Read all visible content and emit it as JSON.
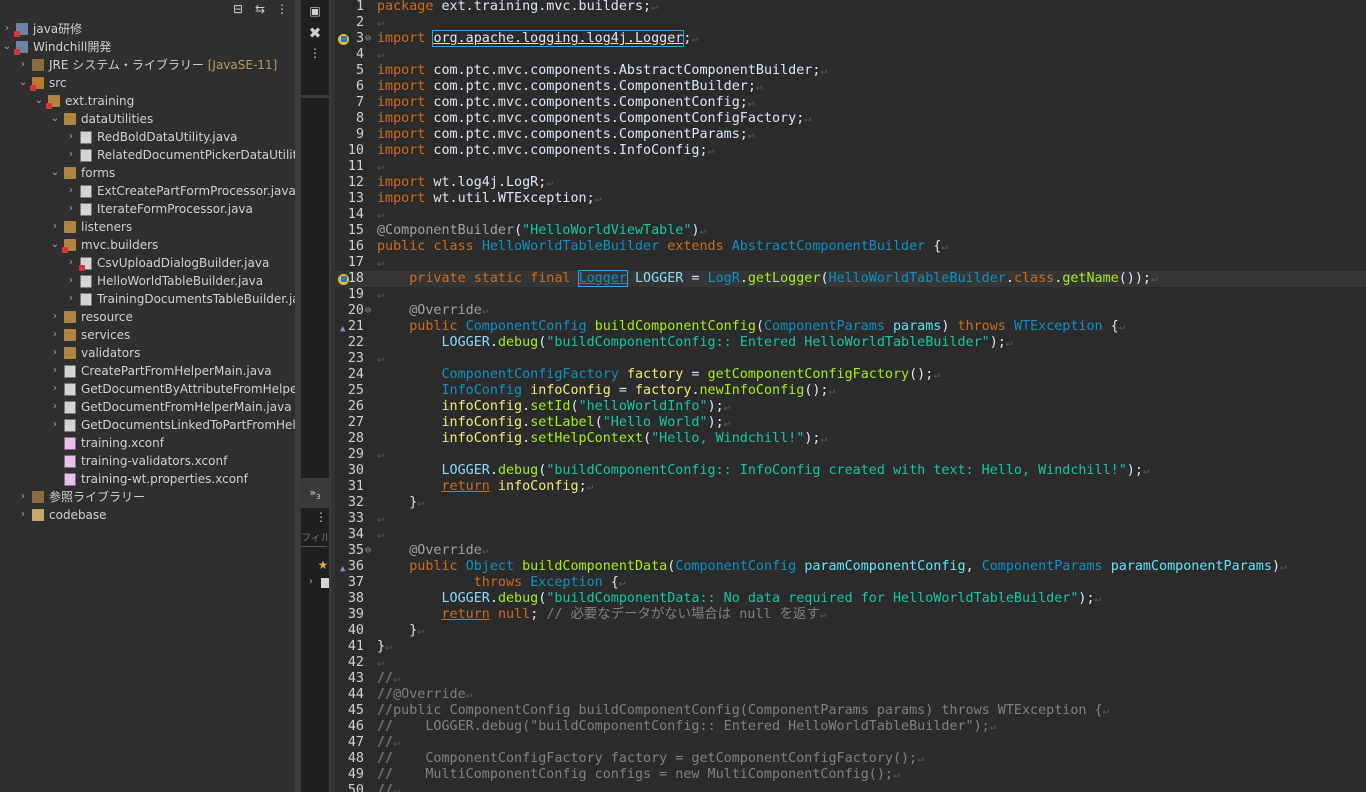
{
  "explorer": {
    "toolbar": [
      "collapse-all-icon",
      "link-editor-icon",
      "view-menu-icon"
    ],
    "items": [
      {
        "label": "java研修",
        "depth": 0,
        "expanded": false,
        "icon": "project-icon",
        "error": true
      },
      {
        "label": "Windchill開発",
        "depth": 0,
        "expanded": true,
        "icon": "project-icon",
        "error": true
      },
      {
        "label": "JRE システム・ライブラリー",
        "decoration": "[JavaSE-11]",
        "depth": 1,
        "expanded": false,
        "icon": "library-icon"
      },
      {
        "label": "src",
        "depth": 1,
        "expanded": true,
        "icon": "source-folder-icon",
        "error": true
      },
      {
        "label": "ext.training",
        "depth": 2,
        "expanded": true,
        "icon": "package-icon",
        "error": true
      },
      {
        "label": "dataUtilities",
        "depth": 3,
        "expanded": true,
        "icon": "package-icon"
      },
      {
        "label": "RedBoldDataUtility.java",
        "depth": 4,
        "expanded": false,
        "icon": "java-file-icon"
      },
      {
        "label": "RelatedDocumentPickerDataUtility.java",
        "depth": 4,
        "expanded": false,
        "icon": "java-file-icon"
      },
      {
        "label": "forms",
        "depth": 3,
        "expanded": true,
        "icon": "package-icon"
      },
      {
        "label": "ExtCreatePartFormProcessor.java",
        "depth": 4,
        "expanded": false,
        "icon": "java-file-icon"
      },
      {
        "label": "IterateFormProcessor.java",
        "depth": 4,
        "expanded": false,
        "icon": "java-file-icon"
      },
      {
        "label": "listeners",
        "depth": 3,
        "expanded": false,
        "icon": "package-icon"
      },
      {
        "label": "mvc.builders",
        "depth": 3,
        "expanded": true,
        "icon": "package-icon",
        "error": true
      },
      {
        "label": "CsvUploadDialogBuilder.java",
        "depth": 4,
        "expanded": false,
        "icon": "java-file-icon",
        "error": true
      },
      {
        "label": "HelloWorldTableBuilder.java",
        "depth": 4,
        "expanded": false,
        "icon": "java-file-icon"
      },
      {
        "label": "TrainingDocumentsTableBuilder.java",
        "depth": 4,
        "expanded": false,
        "icon": "java-file-icon"
      },
      {
        "label": "resource",
        "depth": 3,
        "expanded": false,
        "icon": "package-icon"
      },
      {
        "label": "services",
        "depth": 3,
        "expanded": false,
        "icon": "package-icon"
      },
      {
        "label": "validators",
        "depth": 3,
        "expanded": false,
        "icon": "package-icon"
      },
      {
        "label": "CreatePartFromHelperMain.java",
        "depth": 3,
        "expanded": false,
        "icon": "java-file-icon"
      },
      {
        "label": "GetDocumentByAttributeFromHelperMain.java",
        "depth": 3,
        "expanded": false,
        "icon": "java-file-icon"
      },
      {
        "label": "GetDocumentFromHelperMain.java",
        "depth": 3,
        "expanded": false,
        "icon": "java-file-icon"
      },
      {
        "label": "GetDocumentsLinkedToPartFromHelperMain.java",
        "depth": 3,
        "expanded": false,
        "icon": "java-file-icon"
      },
      {
        "label": "training.xconf",
        "depth": 3,
        "leaf": true,
        "icon": "xconf-file-icon"
      },
      {
        "label": "training-validators.xconf",
        "depth": 3,
        "leaf": true,
        "icon": "xconf-file-icon"
      },
      {
        "label": "training-wt.properties.xconf",
        "depth": 3,
        "leaf": true,
        "icon": "xconf-file-icon"
      },
      {
        "label": "参照ライブラリー",
        "depth": 1,
        "expanded": false,
        "icon": "library-icon"
      },
      {
        "label": "codebase",
        "depth": 1,
        "expanded": false,
        "icon": "folder-icon"
      }
    ]
  },
  "side_panel": {
    "overflow_label": "»",
    "overflow_count": "3",
    "filter_placeholder": "フィルタ"
  },
  "editor": {
    "lines": [
      {
        "n": "1",
        "t": [
          [
            "kw",
            "package"
          ],
          [
            "p",
            " ext.training.mvc.builders;"
          ]
        ]
      },
      {
        "n": "2",
        "t": []
      },
      {
        "n": "3",
        "marker": "warning",
        "fold": "⊖",
        "t": [
          [
            "kw",
            "import"
          ],
          [
            "p",
            " "
          ],
          [
            "hl",
            "org.apache.logging.log4j.Logger"
          ],
          [
            "p",
            ";"
          ]
        ]
      },
      {
        "n": "4",
        "t": []
      },
      {
        "n": "5",
        "t": [
          [
            "kw",
            "import"
          ],
          [
            "p",
            " com.ptc.mvc.components.AbstractComponentBuilder;"
          ]
        ]
      },
      {
        "n": "6",
        "t": [
          [
            "kw",
            "import"
          ],
          [
            "p",
            " com.ptc.mvc.components.ComponentBuilder;"
          ]
        ]
      },
      {
        "n": "7",
        "t": [
          [
            "kw",
            "import"
          ],
          [
            "p",
            " com.ptc.mvc.components.ComponentConfig;"
          ]
        ]
      },
      {
        "n": "8",
        "t": [
          [
            "kw",
            "import"
          ],
          [
            "p",
            " com.ptc.mvc.components.ComponentConfigFactory;"
          ]
        ]
      },
      {
        "n": "9",
        "t": [
          [
            "kw",
            "import"
          ],
          [
            "p",
            " com.ptc.mvc.components.ComponentParams;"
          ]
        ]
      },
      {
        "n": "10",
        "t": [
          [
            "kw",
            "import"
          ],
          [
            "p",
            " com.ptc.mvc.components.InfoConfig;"
          ]
        ]
      },
      {
        "n": "11",
        "t": []
      },
      {
        "n": "12",
        "t": [
          [
            "kw",
            "import"
          ],
          [
            "p",
            " wt.log4j.LogR;"
          ]
        ]
      },
      {
        "n": "13",
        "t": [
          [
            "kw",
            "import"
          ],
          [
            "p",
            " wt.util.WTException;"
          ]
        ]
      },
      {
        "n": "14",
        "t": []
      },
      {
        "n": "15",
        "t": [
          [
            "ann",
            "@ComponentBuilder"
          ],
          [
            "p",
            "("
          ],
          [
            "str",
            "\"HelloWorldViewTable\""
          ],
          [
            "p",
            ")"
          ]
        ]
      },
      {
        "n": "16",
        "t": [
          [
            "kw",
            "public"
          ],
          [
            "p",
            " "
          ],
          [
            "kw",
            "class"
          ],
          [
            "p",
            " "
          ],
          [
            "typ",
            "HelloWorldTableBuilder"
          ],
          [
            "p",
            " "
          ],
          [
            "kw",
            "extends"
          ],
          [
            "p",
            " "
          ],
          [
            "typ",
            "AbstractComponentBuilder"
          ],
          [
            "p",
            " {"
          ]
        ]
      },
      {
        "n": "17",
        "t": []
      },
      {
        "n": "18",
        "marker": "warning",
        "current": true,
        "t": [
          [
            "p",
            "    "
          ],
          [
            "kw",
            "private"
          ],
          [
            "p",
            " "
          ],
          [
            "kw",
            "static"
          ],
          [
            "p",
            " "
          ],
          [
            "kw",
            "final"
          ],
          [
            "p",
            " "
          ],
          [
            "hl",
            "Logger"
          ],
          [
            "p",
            " "
          ],
          [
            "fld",
            "LOGGER"
          ],
          [
            "p",
            " = "
          ],
          [
            "typ",
            "LogR"
          ],
          [
            "p",
            "."
          ],
          [
            "mth",
            "getLogger"
          ],
          [
            "p",
            "("
          ],
          [
            "typ",
            "HelloWorldTableBuilder"
          ],
          [
            "p",
            "."
          ],
          [
            "kw",
            "class"
          ],
          [
            "p",
            "."
          ],
          [
            "mth",
            "getName"
          ],
          [
            "p",
            "());"
          ]
        ]
      },
      {
        "n": "19",
        "t": []
      },
      {
        "n": "20",
        "fold": "⊖",
        "t": [
          [
            "p",
            "    "
          ],
          [
            "ann",
            "@Override"
          ]
        ]
      },
      {
        "n": "21",
        "marker": "override",
        "t": [
          [
            "p",
            "    "
          ],
          [
            "kw",
            "public"
          ],
          [
            "p",
            " "
          ],
          [
            "typ",
            "ComponentConfig"
          ],
          [
            "p",
            " "
          ],
          [
            "mth",
            "buildComponentConfig"
          ],
          [
            "p",
            "("
          ],
          [
            "typ",
            "ComponentParams"
          ],
          [
            "p",
            " "
          ],
          [
            "prm",
            "params"
          ],
          [
            "p",
            ") "
          ],
          [
            "kw",
            "throws"
          ],
          [
            "p",
            " "
          ],
          [
            "typ",
            "WTException"
          ],
          [
            "p",
            " {"
          ]
        ]
      },
      {
        "n": "22",
        "t": [
          [
            "p",
            "        "
          ],
          [
            "fld",
            "LOGGER"
          ],
          [
            "p",
            "."
          ],
          [
            "mth",
            "debug"
          ],
          [
            "p",
            "("
          ],
          [
            "str",
            "\"buildComponentConfig:: Entered HelloWorldTableBuilder\""
          ],
          [
            "p",
            ");"
          ]
        ]
      },
      {
        "n": "23",
        "t": []
      },
      {
        "n": "24",
        "t": [
          [
            "p",
            "        "
          ],
          [
            "typ",
            "ComponentConfigFactory"
          ],
          [
            "p",
            " "
          ],
          [
            "loc",
            "factory"
          ],
          [
            "p",
            " = "
          ],
          [
            "mth",
            "getComponentConfigFactory"
          ],
          [
            "p",
            "();"
          ]
        ]
      },
      {
        "n": "25",
        "t": [
          [
            "p",
            "        "
          ],
          [
            "typ",
            "InfoConfig"
          ],
          [
            "p",
            " "
          ],
          [
            "loc",
            "infoConfig"
          ],
          [
            "p",
            " = "
          ],
          [
            "loc",
            "factory"
          ],
          [
            "p",
            "."
          ],
          [
            "mth",
            "newInfoConfig"
          ],
          [
            "p",
            "();"
          ]
        ]
      },
      {
        "n": "26",
        "t": [
          [
            "p",
            "        "
          ],
          [
            "loc",
            "infoConfig"
          ],
          [
            "p",
            "."
          ],
          [
            "mth",
            "setId"
          ],
          [
            "p",
            "("
          ],
          [
            "str",
            "\"helloWorldInfo\""
          ],
          [
            "p",
            ");"
          ]
        ]
      },
      {
        "n": "27",
        "t": [
          [
            "p",
            "        "
          ],
          [
            "loc",
            "infoConfig"
          ],
          [
            "p",
            "."
          ],
          [
            "mth",
            "setLabel"
          ],
          [
            "p",
            "("
          ],
          [
            "str",
            "\"Hello World\""
          ],
          [
            "p",
            ");"
          ]
        ]
      },
      {
        "n": "28",
        "t": [
          [
            "p",
            "        "
          ],
          [
            "loc",
            "infoConfig"
          ],
          [
            "p",
            "."
          ],
          [
            "mth",
            "setHelpContext"
          ],
          [
            "p",
            "("
          ],
          [
            "str",
            "\"Hello, Windchill!\""
          ],
          [
            "p",
            ");"
          ]
        ]
      },
      {
        "n": "29",
        "t": []
      },
      {
        "n": "30",
        "t": [
          [
            "p",
            "        "
          ],
          [
            "fld",
            "LOGGER"
          ],
          [
            "p",
            "."
          ],
          [
            "mth",
            "debug"
          ],
          [
            "p",
            "("
          ],
          [
            "str",
            "\"buildComponentConfig:: InfoConfig created with text: Hello, Windchill!\""
          ],
          [
            "p",
            ");"
          ]
        ]
      },
      {
        "n": "31",
        "t": [
          [
            "p",
            "        "
          ],
          [
            "kwu",
            "return"
          ],
          [
            "p",
            " "
          ],
          [
            "loc",
            "infoConfig"
          ],
          [
            "p",
            ";"
          ]
        ]
      },
      {
        "n": "32",
        "t": [
          [
            "p",
            "    }"
          ]
        ]
      },
      {
        "n": "33",
        "t": []
      },
      {
        "n": "34",
        "t": []
      },
      {
        "n": "35",
        "fold": "⊖",
        "t": [
          [
            "p",
            "    "
          ],
          [
            "ann",
            "@Override"
          ]
        ]
      },
      {
        "n": "36",
        "marker": "override",
        "t": [
          [
            "p",
            "    "
          ],
          [
            "kw",
            "public"
          ],
          [
            "p",
            " "
          ],
          [
            "typ",
            "Object"
          ],
          [
            "p",
            " "
          ],
          [
            "mth",
            "buildComponentData"
          ],
          [
            "p",
            "("
          ],
          [
            "typ",
            "ComponentConfig"
          ],
          [
            "p",
            " "
          ],
          [
            "prm",
            "paramComponentConfig"
          ],
          [
            "p",
            ", "
          ],
          [
            "typ",
            "ComponentParams"
          ],
          [
            "p",
            " "
          ],
          [
            "prm",
            "paramComponentParams"
          ],
          [
            "p",
            ")"
          ]
        ]
      },
      {
        "n": "37",
        "t": [
          [
            "p",
            "            "
          ],
          [
            "kw",
            "throws"
          ],
          [
            "p",
            " "
          ],
          [
            "typ",
            "Exception"
          ],
          [
            "p",
            " {"
          ]
        ]
      },
      {
        "n": "38",
        "t": [
          [
            "p",
            "        "
          ],
          [
            "fld",
            "LOGGER"
          ],
          [
            "p",
            "."
          ],
          [
            "mth",
            "debug"
          ],
          [
            "p",
            "("
          ],
          [
            "str",
            "\"buildComponentData:: No data required for HelloWorldTableBuilder\""
          ],
          [
            "p",
            ");"
          ]
        ]
      },
      {
        "n": "39",
        "t": [
          [
            "p",
            "        "
          ],
          [
            "kwu",
            "return"
          ],
          [
            "p",
            " "
          ],
          [
            "kw",
            "null"
          ],
          [
            "p",
            "; "
          ],
          [
            "cmt",
            "// 必要なデータがない場合は null を返す"
          ]
        ]
      },
      {
        "n": "40",
        "t": [
          [
            "p",
            "    }"
          ]
        ]
      },
      {
        "n": "41",
        "t": [
          [
            "p",
            "}"
          ]
        ]
      },
      {
        "n": "42",
        "t": []
      },
      {
        "n": "43",
        "t": [
          [
            "cmt",
            "//"
          ]
        ]
      },
      {
        "n": "44",
        "t": [
          [
            "cmt",
            "//@Override"
          ]
        ]
      },
      {
        "n": "45",
        "t": [
          [
            "cmt",
            "//public ComponentConfig buildComponentConfig(ComponentParams params) throws WTException {"
          ]
        ]
      },
      {
        "n": "46",
        "t": [
          [
            "cmt",
            "//    LOGGER.debug(\"buildComponentConfig:: Entered HelloWorldTableBuilder\");"
          ]
        ]
      },
      {
        "n": "47",
        "t": [
          [
            "cmt",
            "//"
          ]
        ]
      },
      {
        "n": "48",
        "t": [
          [
            "cmt",
            "//    ComponentConfigFactory factory = getComponentConfigFactory();"
          ]
        ]
      },
      {
        "n": "49",
        "t": [
          [
            "cmt",
            "//    MultiComponentConfig configs = new MultiComponentConfig();"
          ]
        ]
      },
      {
        "n": "50",
        "t": [
          [
            "cmt",
            "//"
          ]
        ]
      }
    ]
  }
}
